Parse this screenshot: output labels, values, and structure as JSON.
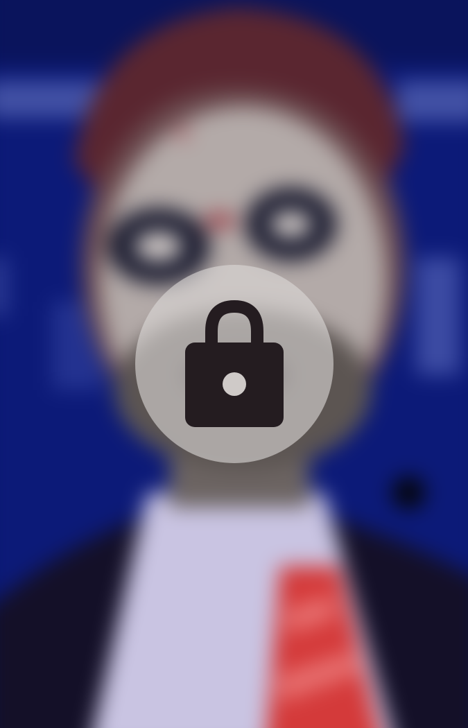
{
  "overlay": {
    "icon": "lock-icon",
    "state": "locked"
  },
  "colors": {
    "background": "#0c1a78",
    "overlay_circle": "#dcd8d6",
    "lock_glyph": "#241c20"
  }
}
